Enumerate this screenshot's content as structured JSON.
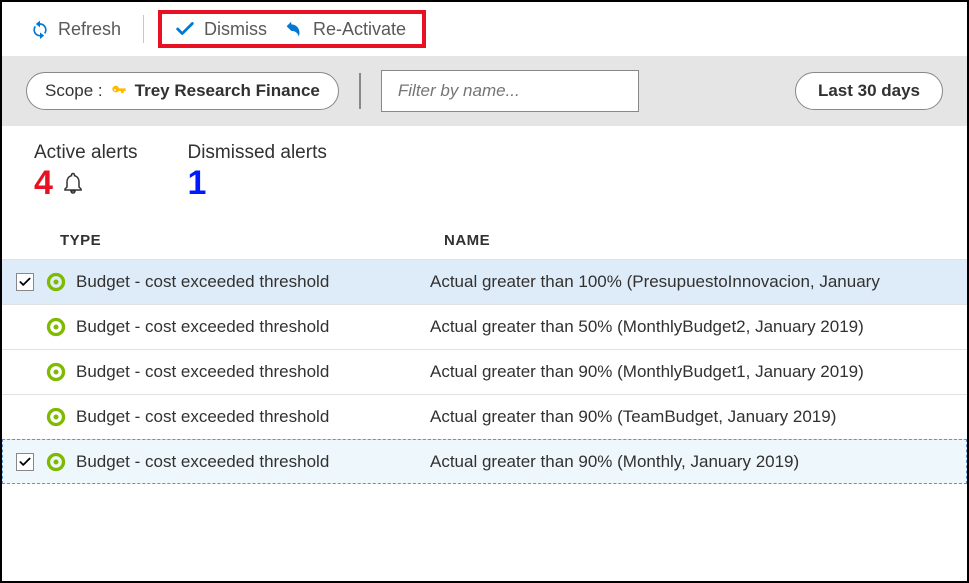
{
  "toolbar": {
    "refresh": "Refresh",
    "dismiss": "Dismiss",
    "reactivate": "Re-Activate"
  },
  "filterbar": {
    "scope_label": "Scope :",
    "scope_value": "Trey Research Finance",
    "filter_placeholder": "Filter by name...",
    "date_range": "Last 30 days"
  },
  "counts": {
    "active_label": "Active alerts",
    "active_value": "4",
    "dismissed_label": "Dismissed alerts",
    "dismissed_value": "1"
  },
  "table": {
    "headers": {
      "type": "TYPE",
      "name": "NAME"
    },
    "rows": [
      {
        "checked": true,
        "selected": true,
        "focus": false,
        "type": "Budget - cost exceeded threshold",
        "name": "Actual greater than 100% (PresupuestoInnovacion, January "
      },
      {
        "checked": false,
        "selected": false,
        "focus": false,
        "type": "Budget - cost exceeded threshold",
        "name": "Actual greater than 50% (MonthlyBudget2, January 2019)"
      },
      {
        "checked": false,
        "selected": false,
        "focus": false,
        "type": "Budget - cost exceeded threshold",
        "name": "Actual greater than 90% (MonthlyBudget1, January 2019)"
      },
      {
        "checked": false,
        "selected": false,
        "focus": false,
        "type": "Budget - cost exceeded threshold",
        "name": "Actual greater than 90% (TeamBudget, January 2019)"
      },
      {
        "checked": true,
        "selected": false,
        "focus": true,
        "type": "Budget - cost exceeded threshold",
        "name": "Actual greater than 90% (Monthly, January 2019)"
      }
    ]
  },
  "colors": {
    "accent_blue": "#0078d4",
    "red": "#e81123",
    "key_yellow": "#ffb900",
    "budget_green": "#7fba00"
  }
}
